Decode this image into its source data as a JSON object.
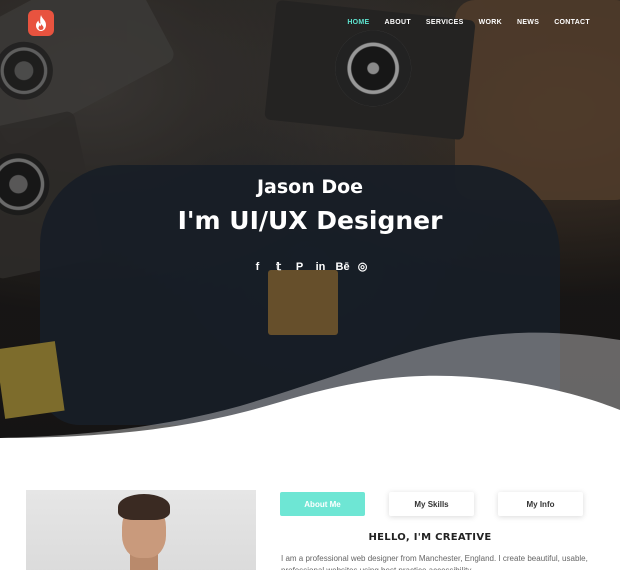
{
  "nav": {
    "items": [
      {
        "label": "HOME",
        "active": true
      },
      {
        "label": "ABOUT",
        "active": false
      },
      {
        "label": "SERVICES",
        "active": false
      },
      {
        "label": "WORK",
        "active": false
      },
      {
        "label": "NEWS",
        "active": false
      },
      {
        "label": "CONTACT",
        "active": false
      }
    ],
    "logo_icon": "flame-icon"
  },
  "hero": {
    "name": "Jason Doe",
    "role": "I'm UI/UX Designer",
    "socials": [
      {
        "icon": "facebook-icon",
        "glyph": "f"
      },
      {
        "icon": "twitter-icon",
        "glyph": "𝕥"
      },
      {
        "icon": "pinterest-icon",
        "glyph": "P"
      },
      {
        "icon": "linkedin-icon",
        "glyph": "in"
      },
      {
        "icon": "behance-icon",
        "glyph": "Bē"
      },
      {
        "icon": "instagram-icon",
        "glyph": "◎"
      }
    ]
  },
  "about": {
    "tabs": [
      {
        "label": "About Me",
        "active": true
      },
      {
        "label": "My Skills",
        "active": false
      },
      {
        "label": "My Info",
        "active": false
      }
    ],
    "heading": "HELLO, I'M CREATIVE",
    "bio": "I am a professional web designer from Manchester, England. I create beautiful, usable, professional websites using best practice accessibility"
  },
  "colors": {
    "accent": "#6ee6d4",
    "nav_active": "#5ee3cf",
    "logo": "#e8533f"
  }
}
